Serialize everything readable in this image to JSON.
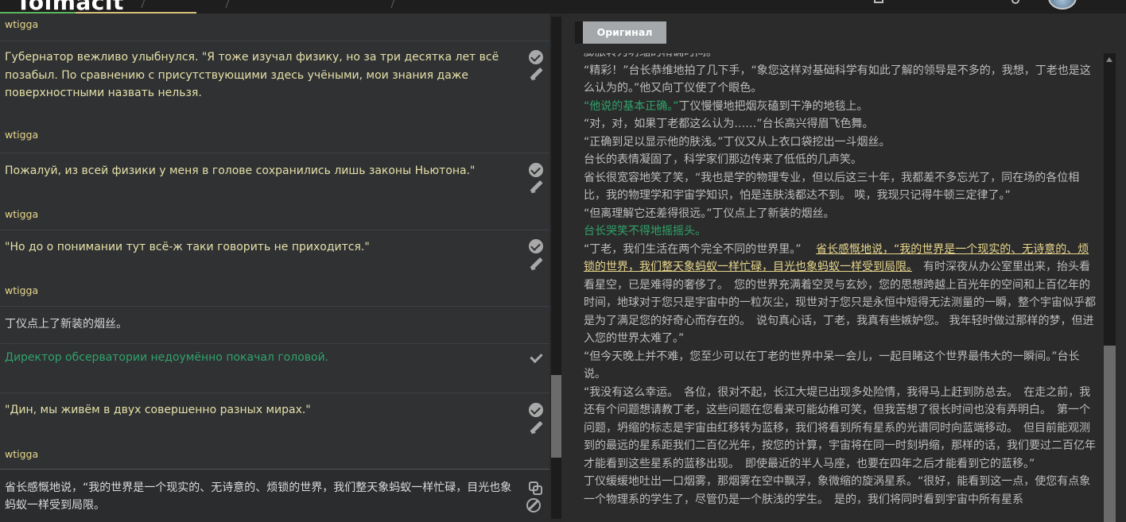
{
  "topbar": {
    "logo": "Tolmačit"
  },
  "segments": [
    {
      "author": "wtigga",
      "text": "",
      "style": "author-only"
    },
    {
      "author": "wtigga",
      "text": "Губернатор вежливо улыбнулся. \"Я тоже изучал физику, но за три десятка лет всё позабыл. По сравнению с присутствующими здесь учёными, мои знания даже поверхностными назвать нельзя.",
      "style": "translated"
    },
    {
      "author": "wtigga",
      "text": "Пожалуй, из всей физики у меня в голове сохранились лишь законы Ньютона.\"",
      "style": "translated"
    },
    {
      "author": "wtigga",
      "text": "\"Но до о понимании тут всё-ж таки говорить не приходится.\"",
      "style": "translated"
    },
    {
      "author": "",
      "text": "丁仪点上了新装的烟丝。",
      "style": "untranslated"
    },
    {
      "author": "",
      "text": "Директор обсерватории недоумённо покачал головой.",
      "style": "approved"
    },
    {
      "author": "wtigga",
      "text": "\"Дин, мы живём в двух совершенно разных мирах.\"",
      "style": "translated"
    }
  ],
  "editor": {
    "text": "省长感慨地说，“我的世界是一个现实的、无诗意的、烦锁的世界，我们整天象蚂蚁一样忙碌，目光也象蚂蚁一样受到局限。"
  },
  "original": {
    "button_label": "Оригинал",
    "lines": [
      {
        "parts": [
          {
            "t": "膨胀转为坍缩的精确时间。",
            "c": ""
          }
        ]
      },
      {
        "parts": [
          {
            "t": "“精彩！”台长恭维地拍了几下手，“象您这样对基础科学有如此了解的领导是不多的，我想，丁老也是这么认为的。”他又向丁仪使了个眼色。",
            "c": ""
          }
        ]
      },
      {
        "parts": [
          {
            "t": "“他说的基本正确。”",
            "c": "green"
          },
          {
            "t": "丁仪慢慢地把烟灰磕到干净的地毯上。",
            "c": ""
          }
        ]
      },
      {
        "parts": [
          {
            "t": "“对，对，如果丁老都这么认为……”台长高兴得眉飞色舞。",
            "c": ""
          }
        ]
      },
      {
        "parts": [
          {
            "t": "“正确到足以显示他的肤浅。”丁仪又从上衣口袋挖出一斗烟丝。",
            "c": ""
          }
        ]
      },
      {
        "parts": [
          {
            "t": "台长的表情凝固了，科学家们那边传来了低低的几声笑。",
            "c": ""
          }
        ]
      },
      {
        "parts": [
          {
            "t": "省长很宽容地笑了笑，“我也是学的物理专业，但以后这三十年，我都差不多忘光了，同在场的各位相比，我的物理学和宇宙学知识，怕是连肤浅都达不到。 唉，我现只记得牛顿三定律了。”",
            "c": ""
          }
        ]
      },
      {
        "parts": [
          {
            "t": "“但离理解它还差得很远。”丁仪点上了新装的烟丝。",
            "c": ""
          }
        ]
      },
      {
        "parts": [
          {
            "t": "台长哭笑不得地摇摇头。",
            "c": "green"
          }
        ]
      },
      {
        "parts": [
          {
            "t": "“丁老，我们生活在两个完全不同的世界里。”　 ",
            "c": ""
          },
          {
            "t": "省长感慨地说，“我的世界是一个现实的、无诗意的、烦锁的世界，我们整天象蚂蚁一样忙碌，目光也象蚂蚁一样受到局限。",
            "c": "hl"
          },
          {
            "t": "　有时深夜从办公室里出来，抬头看看星空，已是难得的奢侈了。　您的世界充满着空灵与玄妙，您的思想跨越上百光年的空间和上百亿年的时间，地球对于您只是宇宙中的一粒灰尘，现世对于您只是永恒中短得无法测量的一瞬，整个宇宙似乎都是为了满足您的好奇心而存在的。　说句真心话，丁老，我真有些嫉妒您。 我年轻时做过那样的梦，但进入您的世界太难了。”",
            "c": ""
          }
        ]
      },
      {
        "parts": [
          {
            "t": "“但今天晚上并不难，您至少可以在丁老的世界中呆一会儿，一起目睹这个世界最伟大的一瞬间。”台长说。",
            "c": ""
          }
        ]
      },
      {
        "parts": [
          {
            "t": "“我没有这么幸运。　各位，很对不起，长江大堤已出现多处险情，我得马上赶到防总去。　在走之前，我还有个问题想请教丁老，这些问题在您看来可能幼稚可笑，但我苦想了很长时间也没有弄明白。　第一个问题，坍缩的标志是宇宙由红移转为蓝移，我们将看到所有星系的光谱同时向蓝端移动。　但目前能观测到的最远的星系距我们二百亿光年，按您的计算，宇宙将在同一时刻坍缩，那样的话，我们要过二百亿年才能看到这些星系的蓝移出现。　即使最近的半人马座，也要在四年之后才能看到它的蓝移。”",
            "c": ""
          }
        ]
      },
      {
        "parts": [
          {
            "t": "丁仪缓缓地吐出一口烟雾，那烟雾在空中飘浮，象微缩的旋涡星系。“很好，能看到这一点，使您有点象一个物理系的学生了，尽管仍是一个肤浅的学生。　是的，我们将同时看到宇宙中所有星系",
            "c": ""
          }
        ]
      }
    ]
  }
}
